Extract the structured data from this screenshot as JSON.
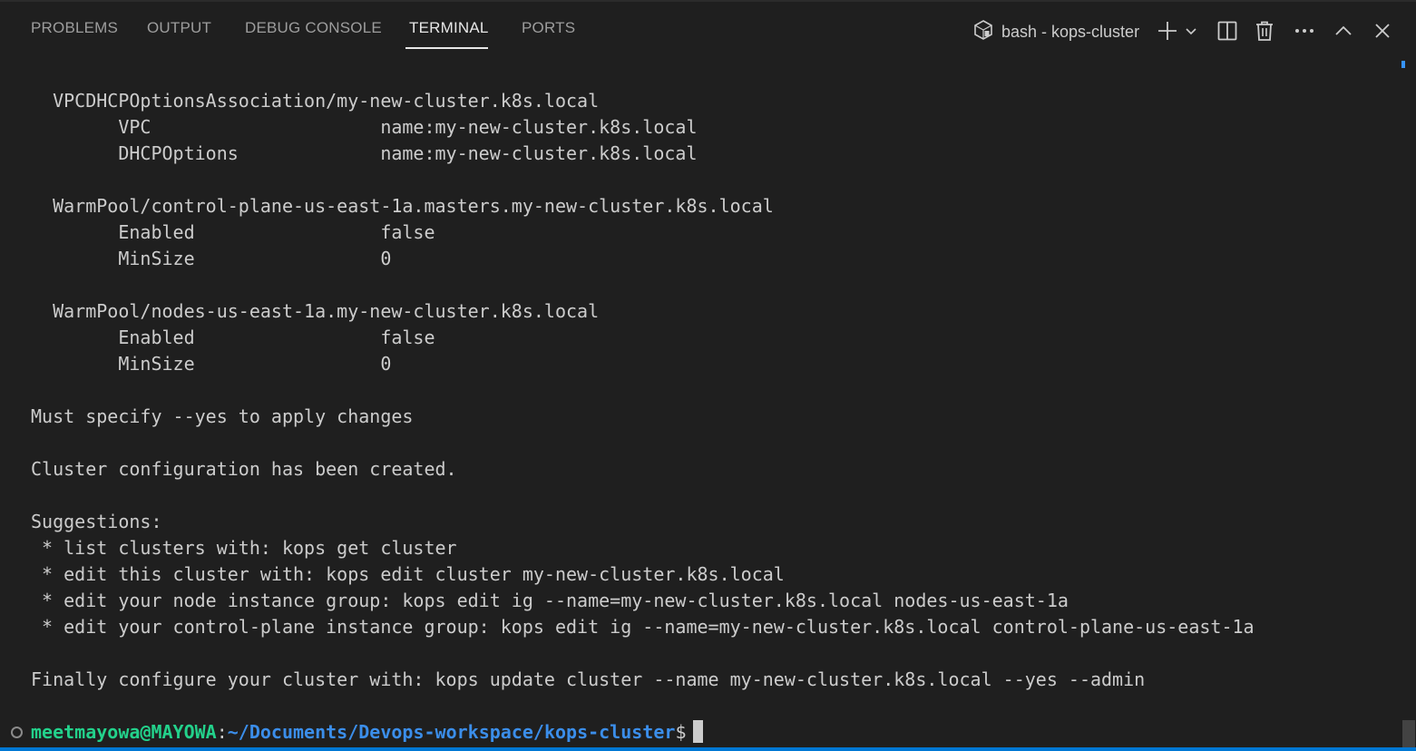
{
  "tabs": [
    {
      "label": "PROBLEMS"
    },
    {
      "label": "OUTPUT"
    },
    {
      "label": "DEBUG CONSOLE"
    },
    {
      "label": "TERMINAL"
    },
    {
      "label": "PORTS"
    }
  ],
  "active_tab": "TERMINAL",
  "terminal_instance": {
    "label": "bash - kops-cluster",
    "icon": "terminal-bash-icon"
  },
  "header_actions": [
    {
      "name": "new-terminal-plus-icon"
    },
    {
      "name": "launch-profile-chevron-down-icon"
    },
    {
      "name": "split-terminal-icon"
    },
    {
      "name": "kill-terminal-trash-icon"
    },
    {
      "name": "more-actions-ellipsis-icon"
    },
    {
      "name": "maximize-panel-chevron-up-icon"
    },
    {
      "name": "close-panel-icon"
    }
  ],
  "output_lines": [
    "  VPCDHCPOptionsAssociation/my-new-cluster.k8s.local",
    "        VPC                     name:my-new-cluster.k8s.local",
    "        DHCPOptions             name:my-new-cluster.k8s.local",
    "",
    "  WarmPool/control-plane-us-east-1a.masters.my-new-cluster.k8s.local",
    "        Enabled                 false",
    "        MinSize                 0",
    "",
    "  WarmPool/nodes-us-east-1a.my-new-cluster.k8s.local",
    "        Enabled                 false",
    "        MinSize                 0",
    "",
    "Must specify --yes to apply changes",
    "",
    "Cluster configuration has been created.",
    "",
    "Suggestions:",
    " * list clusters with: kops get cluster",
    " * edit this cluster with: kops edit cluster my-new-cluster.k8s.local",
    " * edit your node instance group: kops edit ig --name=my-new-cluster.k8s.local nodes-us-east-1a",
    " * edit your control-plane instance group: kops edit ig --name=my-new-cluster.k8s.local control-plane-us-east-1a",
    "",
    "Finally configure your cluster with: kops update cluster --name my-new-cluster.k8s.local --yes --admin"
  ],
  "prompt": {
    "user_host": "meetmayowa@MAYOWA",
    "separator": ":",
    "path": "~/Documents/Devops-workspace/kops-cluster",
    "symbol": "$"
  },
  "colors": {
    "background": "#1f1f1f",
    "text": "#cccccc",
    "user": "#23d18b",
    "path": "#3b8eea",
    "accent": "#0078d4"
  }
}
